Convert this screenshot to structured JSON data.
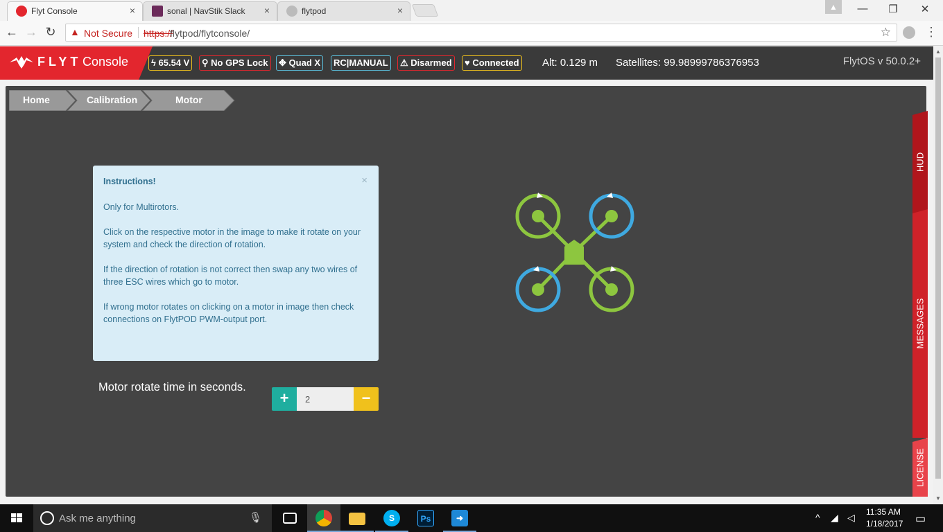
{
  "browser": {
    "tabs": [
      {
        "title": "Flyt Console",
        "close": "×"
      },
      {
        "title": "sonal | NavStik Slack",
        "close": "×"
      },
      {
        "title": "flytpod",
        "close": "×"
      }
    ],
    "security_text": "Not Secure",
    "url_scheme": "https://",
    "url_rest": "flytpod/flytconsole/"
  },
  "header": {
    "brand_flyt": "FLYT",
    "brand_console": "Console",
    "badges": [
      {
        "icon": "lightning-icon",
        "icon_glyph": "ϟ",
        "text": "65.54 V",
        "color": "#f0c11c"
      },
      {
        "icon": "map-marker-icon",
        "icon_glyph": "⚲",
        "text": "No GPS Lock",
        "color": "#e3262e"
      },
      {
        "icon": "arrows-icon",
        "icon_glyph": "✥",
        "text": "Quad X",
        "color": "#5bc0de"
      },
      {
        "icon": "",
        "icon_glyph": "",
        "text": "RC|MANUAL",
        "color": "#5bc0de"
      },
      {
        "icon": "warning-icon",
        "icon_glyph": "⚠",
        "text": "Disarmed",
        "color": "#e3262e"
      },
      {
        "icon": "heart-icon",
        "icon_glyph": "♥",
        "text": "Connected",
        "color": "#f0c11c"
      }
    ],
    "altitude": "Alt: 0.129 m",
    "satellites": "Satellites: 99.98999786376953",
    "version": "FlytOS v 50.0.2+"
  },
  "breadcrumb": [
    "Home",
    "Calibration",
    "Motor"
  ],
  "instructions": {
    "title": "Instructions!",
    "close": "×",
    "paragraphs": [
      "Only for Multirotors.",
      "Click on the respective motor in the image to make it rotate on your system and check the direction of rotation.",
      "If the direction of rotation is not correct then swap any two wires of three ESC wires which go to motor.",
      "If wrong motor rotates on clicking on a motor in image then check connections on FlytPOD PWM-output port."
    ]
  },
  "motor_control": {
    "label": "Motor rotate time in seconds.",
    "plus": "+",
    "minus": "−",
    "value": "2"
  },
  "side_tabs": [
    "HUD",
    "MESSAGES",
    "LICENSE"
  ],
  "colors": {
    "green": "#8dc63f",
    "blue": "#3fa9e0",
    "red": "#e3262e"
  },
  "taskbar": {
    "search_placeholder": "Ask me anything",
    "time": "11:35 AM",
    "date": "1/18/2017"
  }
}
